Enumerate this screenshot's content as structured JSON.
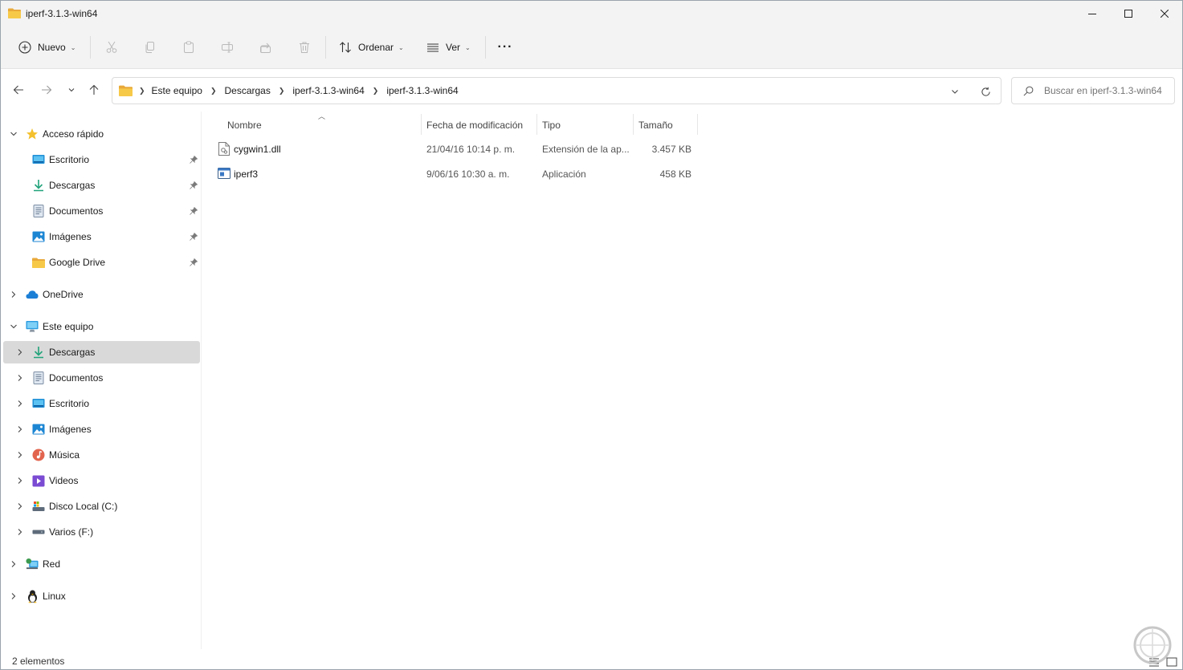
{
  "window": {
    "title": "iperf-3.1.3-win64",
    "controls": {
      "minimize": "—",
      "maximize": "☐",
      "close": "✕"
    }
  },
  "commandbar": {
    "new_label": "Nuevo",
    "sort_label": "Ordenar",
    "view_label": "Ver",
    "more_label": "···",
    "actions": [
      "cut-icon",
      "copy-icon",
      "paste-icon",
      "rename-icon",
      "share-icon",
      "delete-icon"
    ]
  },
  "address": {
    "crumbs": [
      "Este equipo",
      "Descargas",
      "iperf-3.1.3-win64",
      "iperf-3.1.3-win64"
    ],
    "search_placeholder": "Buscar en iperf-3.1.3-win64"
  },
  "sidebar": {
    "quick_access": {
      "label": "Acceso rápido",
      "items": [
        {
          "label": "Escritorio",
          "icon": "desktop-icon"
        },
        {
          "label": "Descargas",
          "icon": "download-icon"
        },
        {
          "label": "Documentos",
          "icon": "documents-icon"
        },
        {
          "label": "Imágenes",
          "icon": "pictures-icon"
        },
        {
          "label": "Google Drive",
          "icon": "folder-icon"
        }
      ]
    },
    "onedrive": "OneDrive",
    "this_pc": {
      "label": "Este equipo",
      "items": [
        {
          "label": "Descargas",
          "icon": "download-icon",
          "selected": true
        },
        {
          "label": "Documentos",
          "icon": "documents-icon"
        },
        {
          "label": "Escritorio",
          "icon": "desktop-icon"
        },
        {
          "label": "Imágenes",
          "icon": "pictures-icon"
        },
        {
          "label": "Música",
          "icon": "music-icon"
        },
        {
          "label": "Videos",
          "icon": "videos-icon"
        },
        {
          "label": "Disco Local (C:)",
          "icon": "drive-c-icon"
        },
        {
          "label": "Varios (F:)",
          "icon": "drive-icon"
        }
      ]
    },
    "network": "Red",
    "linux": "Linux"
  },
  "files": {
    "columns": [
      "Nombre",
      "Fecha de modificación",
      "Tipo",
      "Tamaño"
    ],
    "rows": [
      {
        "name": "cygwin1.dll",
        "date": "21/04/16 10:14 p. m.",
        "type": "Extensión de la ap...",
        "size": "3.457 KB",
        "icon": "dll-file-icon"
      },
      {
        "name": "iperf3",
        "date": "9/06/16 10:30 a. m.",
        "type": "Aplicación",
        "size": "458 KB",
        "icon": "exe-file-icon"
      }
    ]
  },
  "status": {
    "count": "2 elementos"
  },
  "colors": {
    "accent": "#0067c0",
    "selected": "#d9d9d9",
    "chrome": "#f3f3f3",
    "folder": "#f7c948"
  }
}
